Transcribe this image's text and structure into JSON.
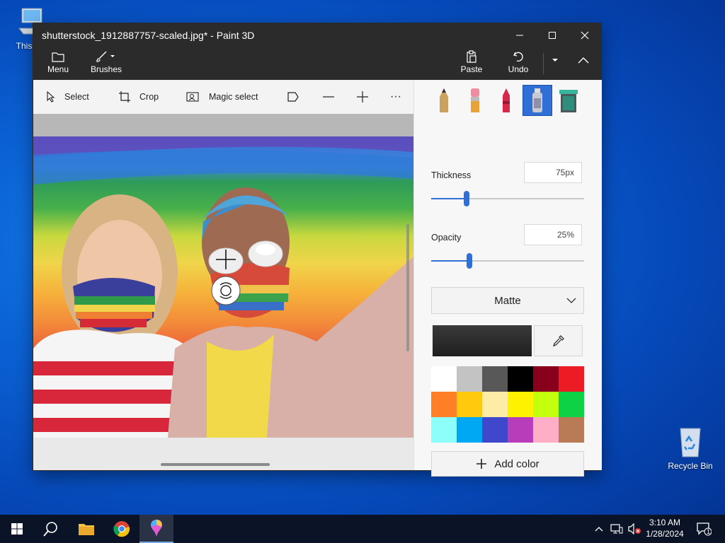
{
  "desktop": {
    "icons": [
      {
        "label": "This PC"
      },
      {
        "label": "Recycle Bin"
      }
    ]
  },
  "window": {
    "title": "shutterstock_1912887757-scaled.jpg* - Paint 3D",
    "controls": {
      "minimize": "minimize",
      "maximize": "maximize",
      "close": "close"
    }
  },
  "ribbon": {
    "menu_label": "Menu",
    "brushes_label": "Brushes",
    "paste_label": "Paste",
    "undo_label": "Undo"
  },
  "toolbar": {
    "select_label": "Select",
    "crop_label": "Crop",
    "magic_select_label": "Magic select",
    "more_label": "···"
  },
  "side_panel": {
    "thickness_label": "Thickness",
    "thickness_value": "75px",
    "thickness_level": 0.23,
    "opacity_label": "Opacity",
    "opacity_value": "25%",
    "opacity_level": 0.25,
    "finish_value": "Matte",
    "current_color": "#1f1f1f",
    "palette": [
      "#ffffff",
      "#c3c3c3",
      "#585858",
      "#000000",
      "#88001b",
      "#ec1c24",
      "#ff7f27",
      "#ffc90e",
      "#fdeca6",
      "#fff200",
      "#c4ff0e",
      "#0ed145",
      "#8cfffb",
      "#00a8f3",
      "#3f48cc",
      "#b83dba",
      "#ffaec8",
      "#b97a56"
    ],
    "add_color_label": "Add color"
  },
  "taskbar": {
    "time": "3:10 AM",
    "date": "1/28/2024",
    "notification_count": "1"
  }
}
